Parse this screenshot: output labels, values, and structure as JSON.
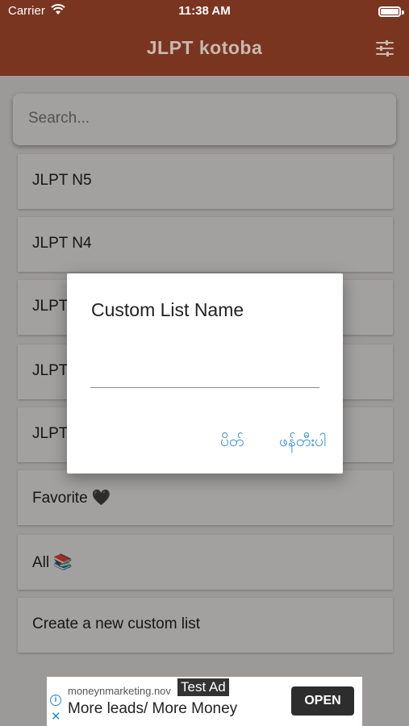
{
  "status_bar": {
    "carrier": "Carrier",
    "time": "11:38 AM"
  },
  "app_bar": {
    "title": "JLPT kotoba"
  },
  "search": {
    "placeholder": "Search..."
  },
  "list": {
    "items": [
      {
        "label": "JLPT N5"
      },
      {
        "label": "JLPT N4"
      },
      {
        "label": "JLPT"
      },
      {
        "label": "JLPT"
      },
      {
        "label": "JLPT"
      },
      {
        "label": "Favorite 🖤"
      },
      {
        "label": "All 📚"
      },
      {
        "label": "Create a new custom list"
      }
    ]
  },
  "dialog": {
    "title": "Custom List Name",
    "input_value": "",
    "cancel_label": "ပိတ်",
    "save_label": "ဖန်တီးပါ"
  },
  "ad": {
    "badge": "Test Ad",
    "domain": "moneynmarketing.nov",
    "headline": "More leads/ More Money",
    "cta": "OPEN"
  },
  "colors": {
    "app_bar": "#7a3520",
    "dialog_button": "#2f8fd6",
    "ad_button": "#2d2d2d"
  }
}
